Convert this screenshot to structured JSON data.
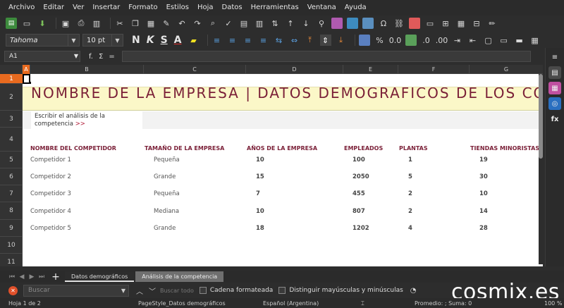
{
  "menu": [
    "Archivo",
    "Editar",
    "Ver",
    "Insertar",
    "Formato",
    "Estilos",
    "Hoja",
    "Datos",
    "Herramientas",
    "Ventana",
    "Ayuda"
  ],
  "toolbar2": {
    "font_name": "Tahoma",
    "font_size": "10 pt",
    "bold": "N",
    "italic": "K",
    "underline": "S",
    "font_color": "A"
  },
  "formula_bar": {
    "name_box": "A1",
    "fx_label": "f.",
    "sigma_label": "Σ",
    "eq_label": "="
  },
  "columns": [
    "A",
    "B",
    "C",
    "D",
    "E",
    "F",
    "G"
  ],
  "rows": [
    "1",
    "2",
    "3",
    "4",
    "5",
    "6",
    "7",
    "8",
    "9",
    "10",
    "11"
  ],
  "sheet": {
    "title": "NOMBRE DE LA EMPRESA | DATOS DEMOGRÁFICOS DE LOS COMPETIDORES",
    "analysis_text": "Escribir el análisis de la competencia",
    "analysis_link": ">>",
    "headers": [
      "NOMBRE DEL COMPETIDOR",
      "TAMAÑO DE LA EMPRESA",
      "AÑOS DE LA EMPRESA",
      "EMPLEADOS",
      "PLANTAS",
      "TIENDAS MINORISTAS"
    ],
    "data": [
      [
        "Competidor 1",
        "Pequeña",
        "10",
        "100",
        "1",
        "19"
      ],
      [
        "Competidor 2",
        "Grande",
        "15",
        "2050",
        "5",
        "30"
      ],
      [
        "Competidor 3",
        "Pequeña",
        "7",
        "455",
        "2",
        "10"
      ],
      [
        "Competidor 4",
        "Mediana",
        "10",
        "807",
        "2",
        "14"
      ],
      [
        "Competidor 5",
        "Grande",
        "18",
        "1202",
        "4",
        "28"
      ]
    ]
  },
  "tabs": [
    "Datos demográficos",
    "Análisis de la competencia"
  ],
  "find": {
    "placeholder": "Buscar",
    "search_all": "Buscar todo",
    "formatted": "Cadena formateada",
    "match_case": "Distinguir mayúsculas y minúsculas"
  },
  "status": {
    "sheet": "Hoja 1 de 2",
    "page_style": "PageStyle_Datos demográficos",
    "language": "Español (Argentina)",
    "summary": "Promedio: ; Suma: 0",
    "zoom": "100 %"
  },
  "watermark": "cosmix.es",
  "colors": {
    "accent": "#e86a1f",
    "title": "#7a1f37",
    "banner": "#fbf7c8"
  }
}
